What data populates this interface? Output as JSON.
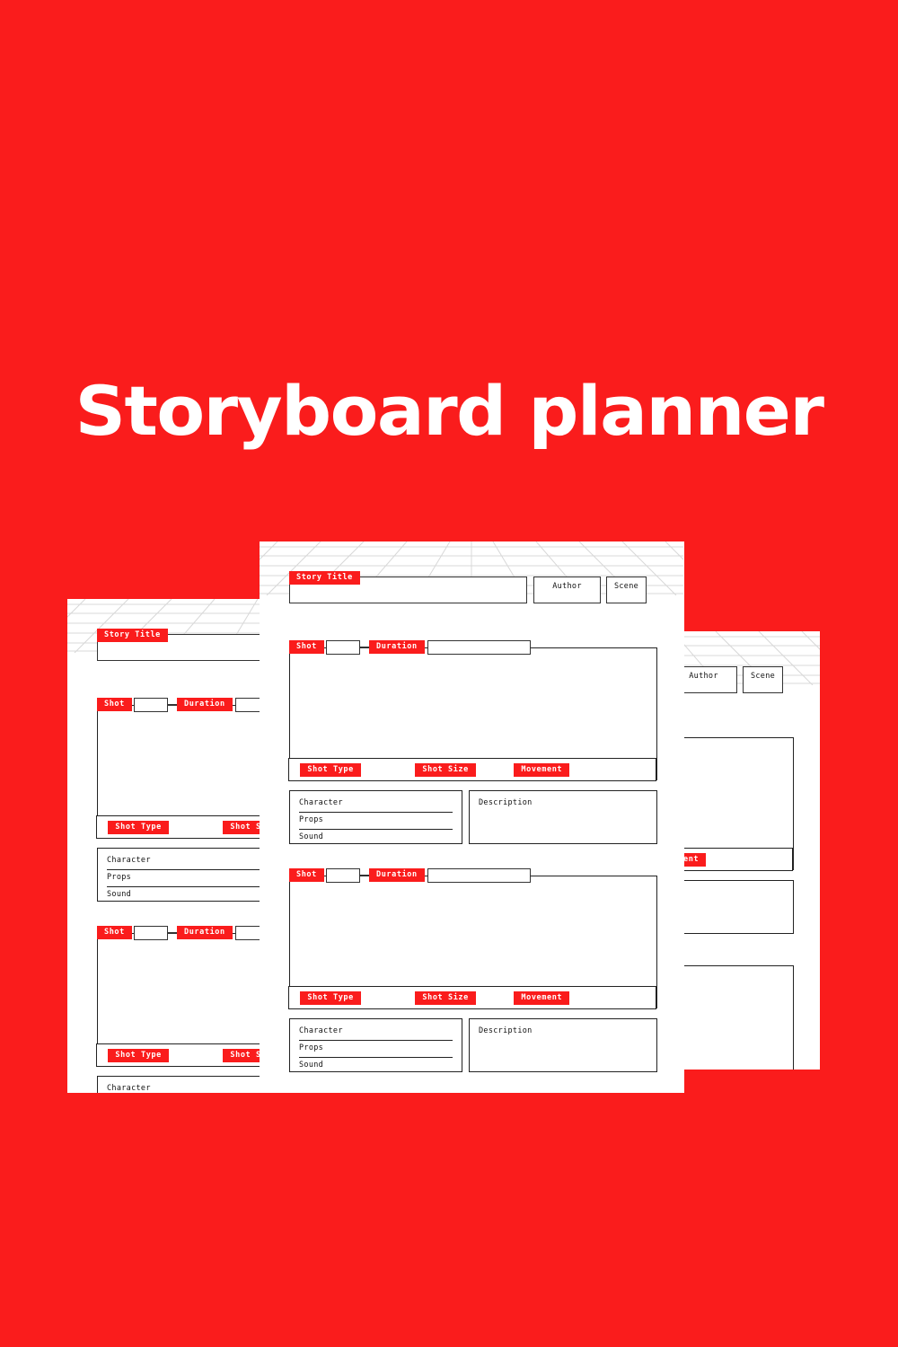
{
  "page": {
    "title": "Storyboard planner",
    "background_color": "#fa1c1c",
    "accent_color": "#fa1c1c",
    "paper_color": "#ffffff",
    "ink_color": "#222222"
  },
  "template": {
    "header": {
      "story_title_label": "Story Title",
      "author_label": "Author",
      "scene_label": "Scene"
    },
    "shot": {
      "shot_label": "Shot",
      "duration_label": "Duration",
      "shot_type_label": "Shot Type",
      "shot_size_label": "Shot Size",
      "movement_label": "Movement"
    },
    "details": {
      "character_label": "Character",
      "props_label": "Props",
      "sound_label": "Sound",
      "description_label": "Description"
    }
  },
  "documents": [
    {
      "name": "left-sheet",
      "shot_count": 2
    },
    {
      "name": "center-sheet",
      "shot_count": 2
    },
    {
      "name": "right-sheet",
      "shot_count": 2
    }
  ]
}
